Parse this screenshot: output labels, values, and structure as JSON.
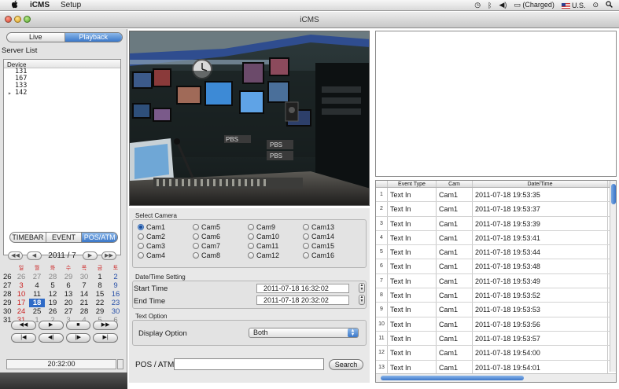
{
  "menubar": {
    "app_name": "iCMS",
    "menu_setup": "Setup",
    "battery_status": "(Charged)",
    "input_source": "U.S."
  },
  "window": {
    "title": "iCMS"
  },
  "mode_tabs": {
    "live": "Live",
    "playback": "Playback",
    "active": "Playback"
  },
  "server_list": {
    "label": "Server List",
    "header": "Device",
    "devices": [
      "131",
      "167",
      "133",
      "142"
    ]
  },
  "view_tabs": {
    "timebar": "TIMEBAR",
    "event": "EVENT",
    "pos_atm": "POS/ATM",
    "active": "POS/ATM"
  },
  "calendar": {
    "title": "2011 / 7",
    "weekday_headers": [
      "일",
      "월",
      "화",
      "수",
      "목",
      "금",
      "토"
    ],
    "weeks": [
      {
        "wk": "26",
        "days": [
          "26",
          "27",
          "28",
          "29",
          "30",
          "1",
          "2"
        ]
      },
      {
        "wk": "27",
        "days": [
          "3",
          "4",
          "5",
          "6",
          "7",
          "8",
          "9"
        ]
      },
      {
        "wk": "28",
        "days": [
          "10",
          "11",
          "12",
          "13",
          "14",
          "15",
          "16"
        ]
      },
      {
        "wk": "29",
        "days": [
          "17",
          "18",
          "19",
          "20",
          "21",
          "22",
          "23"
        ]
      },
      {
        "wk": "30",
        "days": [
          "24",
          "25",
          "26",
          "27",
          "28",
          "29",
          "30"
        ]
      },
      {
        "wk": "31",
        "days": [
          "31",
          "1",
          "2",
          "3",
          "4",
          "5",
          "6"
        ]
      }
    ],
    "selected_day": "18",
    "current_time": "20:32:00"
  },
  "transport": {
    "row1": [
      "◀◀",
      "▶",
      "■",
      "▶▶"
    ],
    "row2": [
      "|◀",
      "◀|",
      "|▶",
      "▶|"
    ]
  },
  "select_camera": {
    "title": "Select Camera",
    "cameras": [
      "Cam1",
      "Cam5",
      "Cam9",
      "Cam13",
      "Cam2",
      "Cam6",
      "Cam10",
      "Cam14",
      "Cam3",
      "Cam7",
      "Cam11",
      "Cam15",
      "Cam4",
      "Cam8",
      "Cam12",
      "Cam16"
    ],
    "selected": "Cam1"
  },
  "datetime_setting": {
    "title": "Date/Time Setting",
    "start_label": "Start Time",
    "start_value": "2011-07-18 16:32:02",
    "end_label": "End Time",
    "end_value": "2011-07-18 20:32:02"
  },
  "text_option": {
    "title": "Text Option",
    "display_label": "Display Option",
    "display_value": "Both"
  },
  "pos_search": {
    "label": "POS / ATM",
    "value": "",
    "search_button": "Search"
  },
  "event_table": {
    "headers": [
      "Event Type",
      "Cam",
      "Date/Time"
    ],
    "rows": [
      {
        "idx": "1",
        "type": "Text In",
        "cam": "Cam1",
        "datetime": "2011-07-18 19:53:35"
      },
      {
        "idx": "2",
        "type": "Text In",
        "cam": "Cam1",
        "datetime": "2011-07-18 19:53:37"
      },
      {
        "idx": "3",
        "type": "Text In",
        "cam": "Cam1",
        "datetime": "2011-07-18 19:53:39"
      },
      {
        "idx": "4",
        "type": "Text In",
        "cam": "Cam1",
        "datetime": "2011-07-18 19:53:41"
      },
      {
        "idx": "5",
        "type": "Text In",
        "cam": "Cam1",
        "datetime": "2011-07-18 19:53:44"
      },
      {
        "idx": "6",
        "type": "Text In",
        "cam": "Cam1",
        "datetime": "2011-07-18 19:53:48"
      },
      {
        "idx": "7",
        "type": "Text In",
        "cam": "Cam1",
        "datetime": "2011-07-18 19:53:49"
      },
      {
        "idx": "8",
        "type": "Text In",
        "cam": "Cam1",
        "datetime": "2011-07-18 19:53:52"
      },
      {
        "idx": "9",
        "type": "Text In",
        "cam": "Cam1",
        "datetime": "2011-07-18 19:53:53"
      },
      {
        "idx": "10",
        "type": "Text In",
        "cam": "Cam1",
        "datetime": "2011-07-18 19:53:56"
      },
      {
        "idx": "11",
        "type": "Text In",
        "cam": "Cam1",
        "datetime": "2011-07-18 19:53:57"
      },
      {
        "idx": "12",
        "type": "Text In",
        "cam": "Cam1",
        "datetime": "2011-07-18 19:54:00"
      },
      {
        "idx": "13",
        "type": "Text In",
        "cam": "Cam1",
        "datetime": "2011-07-18 19:54:01"
      }
    ]
  },
  "camera_view": {
    "signs": [
      "PBS",
      "PBS",
      "PBS"
    ]
  },
  "colors": {
    "accent": "#3a77c8",
    "sunday": "#cc2222",
    "saturday": "#2850a8"
  }
}
